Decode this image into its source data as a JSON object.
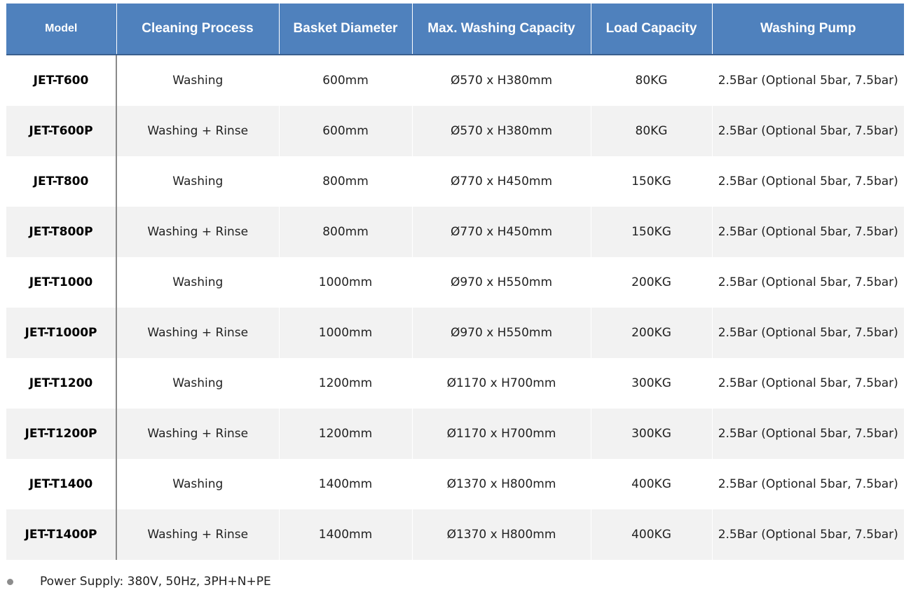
{
  "table": {
    "headers": [
      "Model",
      "Cleaning Process",
      "Basket Diameter",
      "Max. Washing Capacity",
      "Load Capacity",
      "Washing Pump"
    ],
    "rows": [
      [
        "JET-T600",
        "Washing",
        "600mm",
        "Ø570 x H380mm",
        "80KG",
        "2.5Bar (Optional 5bar, 7.5bar)"
      ],
      [
        "JET-T600P",
        "Washing + Rinse",
        "600mm",
        "Ø570 x H380mm",
        "80KG",
        "2.5Bar (Optional 5bar, 7.5bar)"
      ],
      [
        "JET-T800",
        "Washing",
        "800mm",
        "Ø770 x H450mm",
        "150KG",
        "2.5Bar (Optional 5bar, 7.5bar)"
      ],
      [
        "JET-T800P",
        "Washing + Rinse",
        "800mm",
        "Ø770 x H450mm",
        "150KG",
        "2.5Bar (Optional 5bar, 7.5bar)"
      ],
      [
        "JET-T1000",
        "Washing",
        "1000mm",
        "Ø970 x H550mm",
        "200KG",
        "2.5Bar (Optional 5bar, 7.5bar)"
      ],
      [
        "JET-T1000P",
        "Washing + Rinse",
        "1000mm",
        "Ø970 x H550mm",
        "200KG",
        "2.5Bar (Optional 5bar, 7.5bar)"
      ],
      [
        "JET-T1200",
        "Washing",
        "1200mm",
        "Ø1170 x H700mm",
        "300KG",
        "2.5Bar (Optional 5bar, 7.5bar)"
      ],
      [
        "JET-T1200P",
        "Washing + Rinse",
        "1200mm",
        "Ø1170 x H700mm",
        "300KG",
        "2.5Bar (Optional 5bar, 7.5bar)"
      ],
      [
        "JET-T1400",
        "Washing",
        "1400mm",
        "Ø1370 x H800mm",
        "400KG",
        "2.5Bar (Optional 5bar, 7.5bar)"
      ],
      [
        "JET-T1400P",
        "Washing + Rinse",
        "1400mm",
        "Ø1370 x H800mm",
        "400KG",
        "2.5Bar (Optional 5bar, 7.5bar)"
      ]
    ]
  },
  "footnote": {
    "bullet_icon": "bullet-dot-icon",
    "text": "Power Supply: 380V, 50Hz, 3PH+N+PE"
  },
  "colors": {
    "header_bg": "#4f81bd",
    "row_alt_bg": "#f2f2f2"
  }
}
